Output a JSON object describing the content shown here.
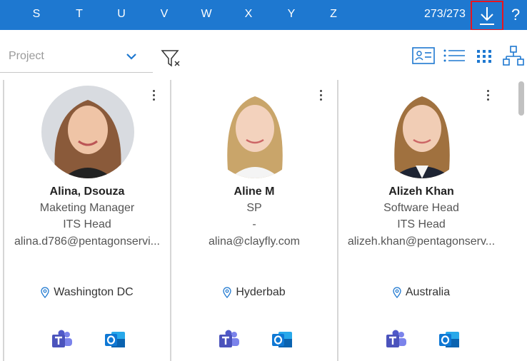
{
  "alphabet": [
    "S",
    "T",
    "U",
    "V",
    "W",
    "X",
    "Y",
    "Z"
  ],
  "record_count": "273/273",
  "help_label": "?",
  "filter": {
    "project_placeholder": "Project"
  },
  "colors": {
    "topbar": "#1e78d0",
    "highlight": "#e8141e",
    "accent": "#1e78d0"
  },
  "icons": {
    "download": "download-icon",
    "help": "help-icon",
    "chevron": "chevron-down-icon",
    "clear_filter": "clear-filter-icon",
    "views": [
      "card-view-icon",
      "list-view-icon",
      "grid-view-icon",
      "org-chart-icon"
    ],
    "location": "location-pin-icon",
    "teams": "teams-icon",
    "outlook": "outlook-icon"
  },
  "employees": [
    {
      "name": "Alina, Dsouza",
      "title": "Maketing Manager",
      "department": "ITS Head",
      "email": "alina.d786@pentagonservi...",
      "location": "Washington DC"
    },
    {
      "name": "Aline M",
      "title": "SP",
      "department": "-",
      "email": "alina@clayfly.com",
      "location": "Hyderbab"
    },
    {
      "name": "Alizeh Khan",
      "title": "Software Head",
      "department": "ITS Head",
      "email": "alizeh.khan@pentagonserv...",
      "location": "Australia"
    }
  ]
}
